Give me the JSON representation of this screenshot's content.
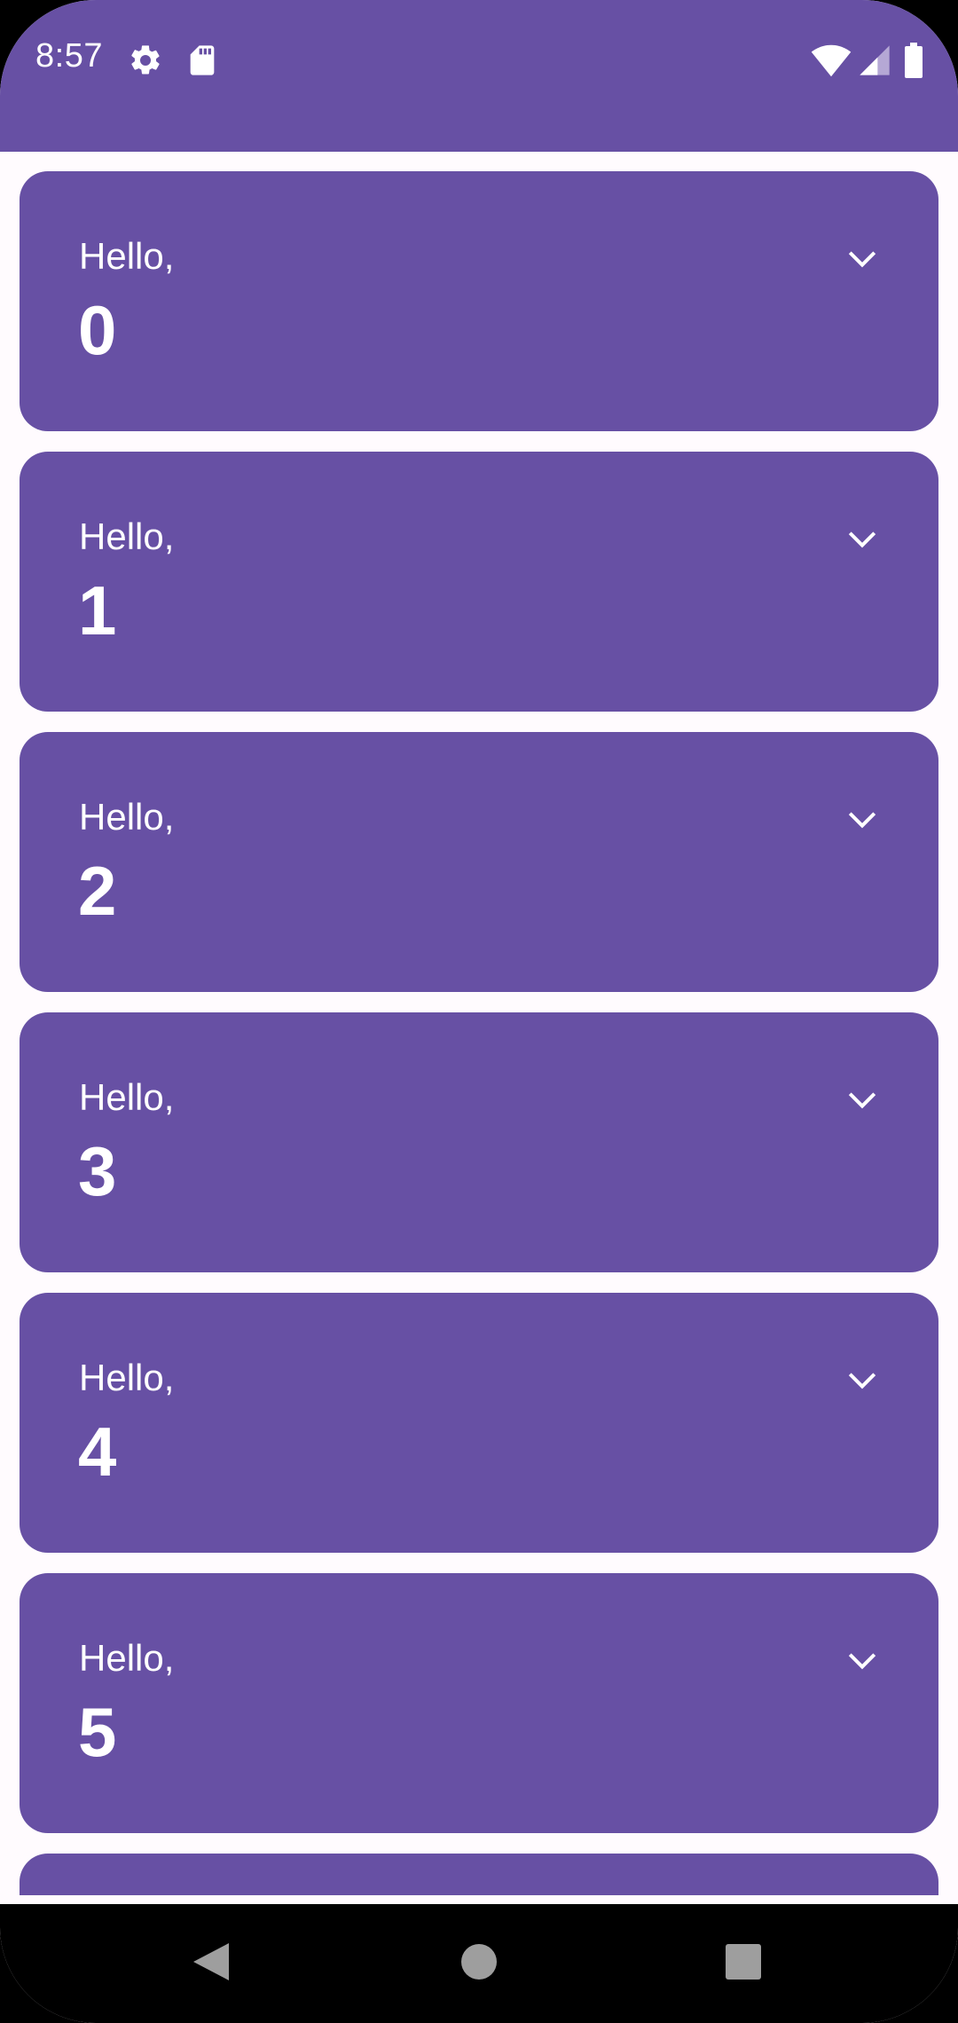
{
  "status_bar": {
    "time": "8:57",
    "background": "#6750A4",
    "icons": [
      "settings-icon",
      "sd-card-icon",
      "wifi-icon",
      "cell-signal-icon",
      "battery-icon"
    ]
  },
  "cards": [
    {
      "greeting": "Hello,",
      "name": "0"
    },
    {
      "greeting": "Hello,",
      "name": "1"
    },
    {
      "greeting": "Hello,",
      "name": "2"
    },
    {
      "greeting": "Hello,",
      "name": "3"
    },
    {
      "greeting": "Hello,",
      "name": "4"
    },
    {
      "greeting": "Hello,",
      "name": "5"
    }
  ],
  "colors": {
    "primary": "#6750A4",
    "background": "#FFFBFE",
    "on_primary": "#FFFFFF"
  },
  "navigation": {
    "buttons": [
      "back-icon",
      "home-icon",
      "recents-icon"
    ]
  }
}
